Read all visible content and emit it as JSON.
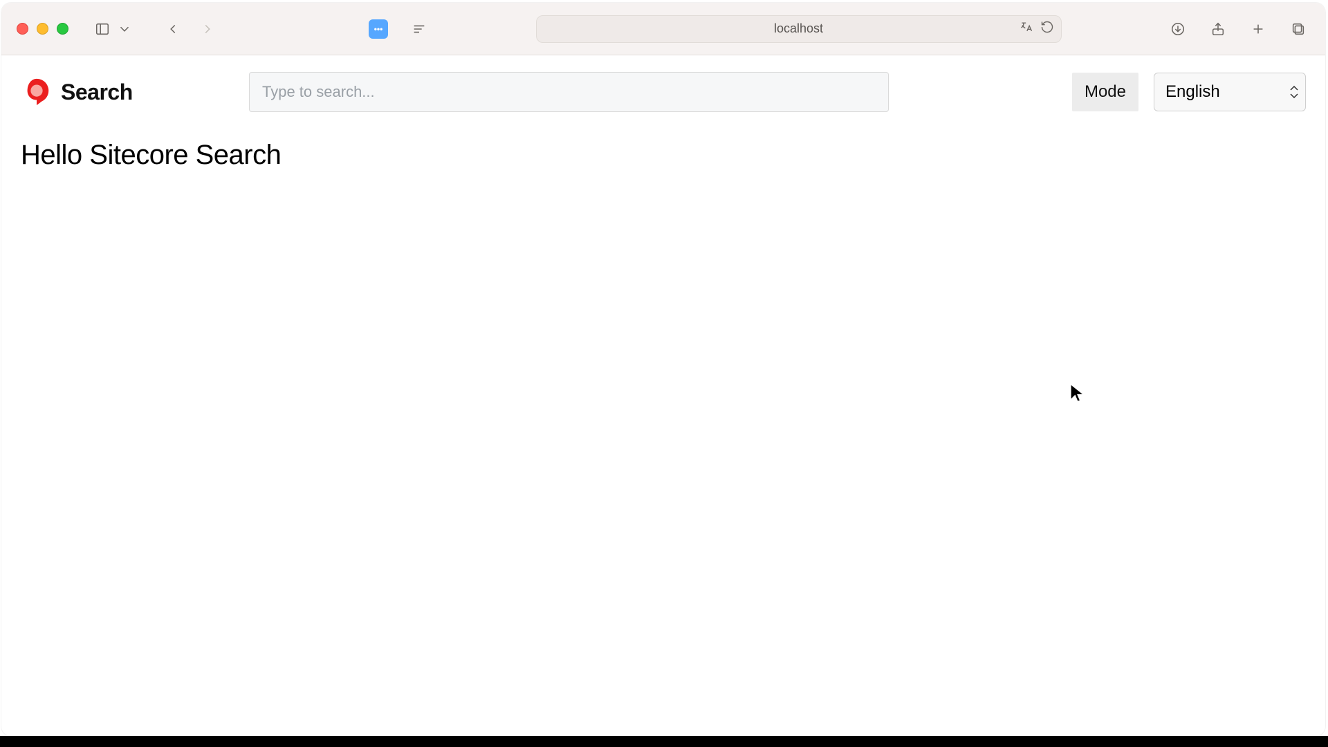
{
  "browser": {
    "address": "localhost"
  },
  "header": {
    "logo_text": "Search",
    "search_placeholder": "Type to search...",
    "mode_button": "Mode",
    "language_selected": "English"
  },
  "main": {
    "heading": "Hello Sitecore Search"
  }
}
